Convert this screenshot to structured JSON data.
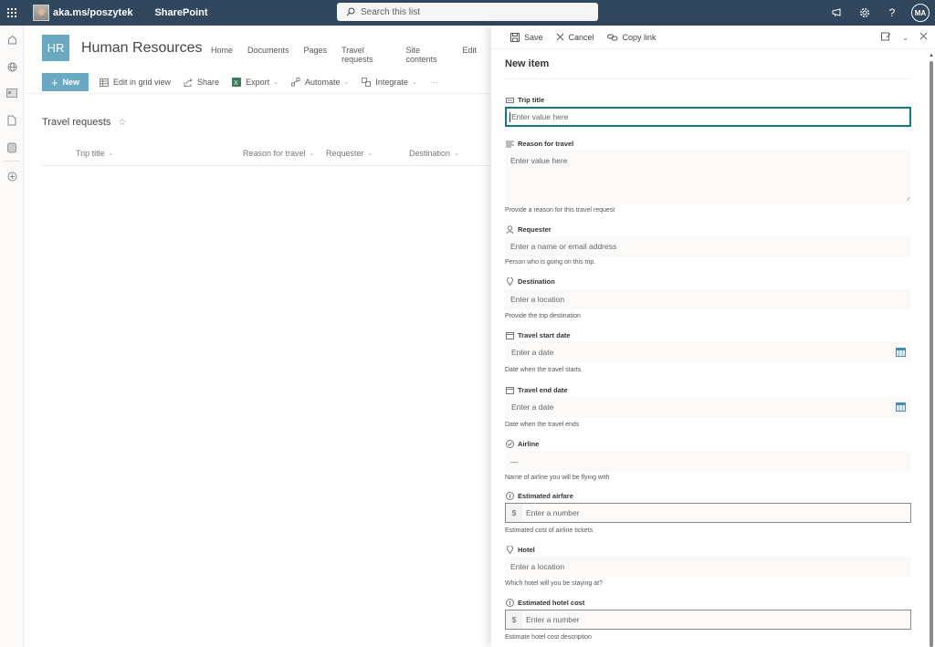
{
  "topbar": {
    "site_link": "aka.ms/poszytek",
    "app_name": "SharePoint",
    "search_placeholder": "Search this list",
    "user_initials": "MA",
    "icons": [
      "waffle-icon",
      "megaphone-icon",
      "gear-icon",
      "help-icon"
    ]
  },
  "leftrail": {
    "icons": [
      "home-icon",
      "globe-icon",
      "news-icon",
      "document-icon",
      "database-icon",
      "add-circle-icon"
    ]
  },
  "site": {
    "logo_text": "HR",
    "title": "Human Resources",
    "nav": [
      "Home",
      "Documents",
      "Pages",
      "Travel requests",
      "Site contents",
      "Edit"
    ]
  },
  "commandbar": {
    "new_label": "New",
    "items": [
      {
        "label": "Edit in grid view",
        "icon": "grid-icon",
        "dropdown": false
      },
      {
        "label": "Share",
        "icon": "share-icon",
        "dropdown": false
      },
      {
        "label": "Export",
        "icon": "excel-icon",
        "dropdown": true
      },
      {
        "label": "Automate",
        "icon": "flow-icon",
        "dropdown": true
      },
      {
        "label": "Integrate",
        "icon": "integrate-icon",
        "dropdown": true
      }
    ],
    "more_label": "···"
  },
  "list": {
    "title": "Travel requests",
    "columns": [
      "Trip title",
      "Reason for travel",
      "Requester",
      "Destination"
    ]
  },
  "panel": {
    "save_label": "Save",
    "cancel_label": "Cancel",
    "copy_link_label": "Copy link",
    "title": "New item",
    "fields": [
      {
        "label": "Trip title",
        "icon": "text-field-icon",
        "placeholder": "Enter value here",
        "help": ""
      },
      {
        "label": "Reason for travel",
        "icon": "multiline-text-icon",
        "placeholder": "Enter value here",
        "help": "Provide a reason for this travel request"
      },
      {
        "label": "Requester",
        "icon": "person-icon",
        "placeholder": "Enter a name or email address",
        "help": "Person who is going on this trip."
      },
      {
        "label": "Destination",
        "icon": "location-pin-icon",
        "placeholder": "Enter a location",
        "help": "Provide the trip destination"
      },
      {
        "label": "Travel start date",
        "icon": "calendar-icon",
        "placeholder": "Enter a date",
        "help": "Date when the travel starts"
      },
      {
        "label": "Travel end date",
        "icon": "calendar-icon",
        "placeholder": "Enter a date",
        "help": "Date when the travel ends"
      },
      {
        "label": "Airline",
        "icon": "choice-icon",
        "placeholder": "—",
        "help": "Name of airline you will be flying with"
      },
      {
        "label": "Estimated airfare",
        "icon": "number-icon",
        "prefix": "$",
        "placeholder": "Enter a number",
        "help": "Estimated cost of airline tickets"
      },
      {
        "label": "Hotel",
        "icon": "location-pin-icon",
        "placeholder": "Enter a location",
        "help": "Which hotel will you be staying at?"
      },
      {
        "label": "Estimated hotel cost",
        "icon": "number-icon",
        "prefix": "$",
        "placeholder": "Enter a number",
        "help": "Estimate hotel cost description"
      }
    ]
  },
  "colors": {
    "topbar_bg": "#31475e",
    "accent": "#6aa9c1",
    "focus_border": "#0e7e7a"
  }
}
